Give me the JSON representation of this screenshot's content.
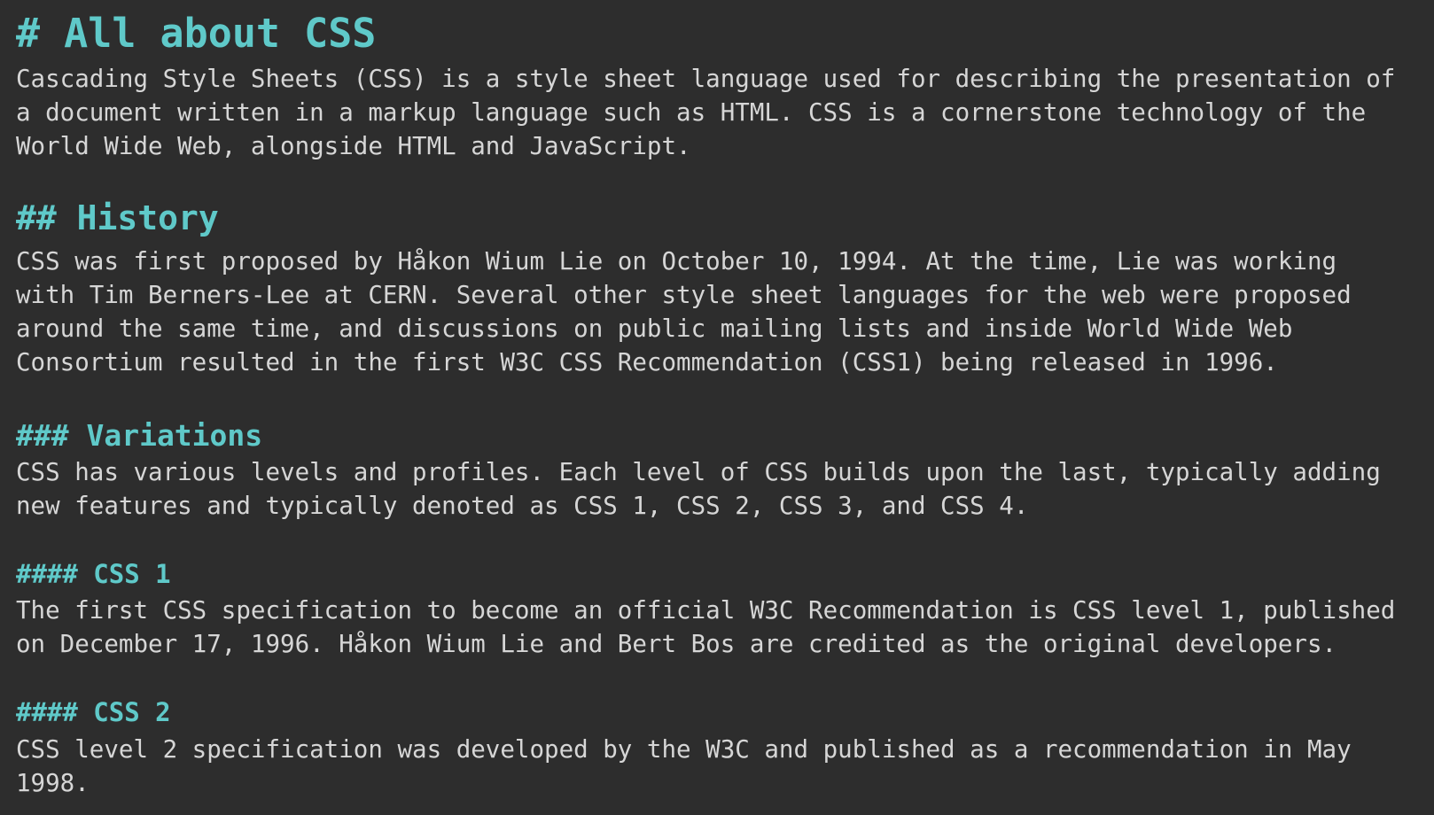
{
  "doc": {
    "title": "# All about CSS",
    "intro": [
      "Cascading Style Sheets (CSS) is a style sheet language used for describing the presentation of",
      "a document written in a markup language such as HTML. CSS is a cornerstone technology of the",
      "World Wide Web, alongside HTML and JavaScript."
    ],
    "history_heading": "## History",
    "history": [
      "CSS was first proposed by Håkon Wium Lie on October 10, 1994. At the time, Lie was working",
      "with Tim Berners-Lee at CERN. Several other style sheet languages for the web were proposed",
      "around the same time, and discussions on public mailing lists and inside World Wide Web",
      "Consortium resulted in the first W3C CSS Recommendation (CSS1) being released in 1996."
    ],
    "variations_heading": "### Variations",
    "variations": [
      "CSS has various levels and profiles. Each level of CSS builds upon the last, typically adding",
      "new features and typically denoted as CSS 1, CSS 2, CSS 3, and CSS 4."
    ],
    "css1_heading": "#### CSS 1",
    "css1": [
      "The first CSS specification to become an official W3C Recommendation is CSS level 1, published",
      "on December 17, 1996. Håkon Wium Lie and Bert Bos are credited as the original developers."
    ],
    "css2_heading": "#### CSS 2",
    "css2": [
      "CSS level 2 specification was developed by the W3C and published as a recommendation in May",
      "1998."
    ]
  }
}
